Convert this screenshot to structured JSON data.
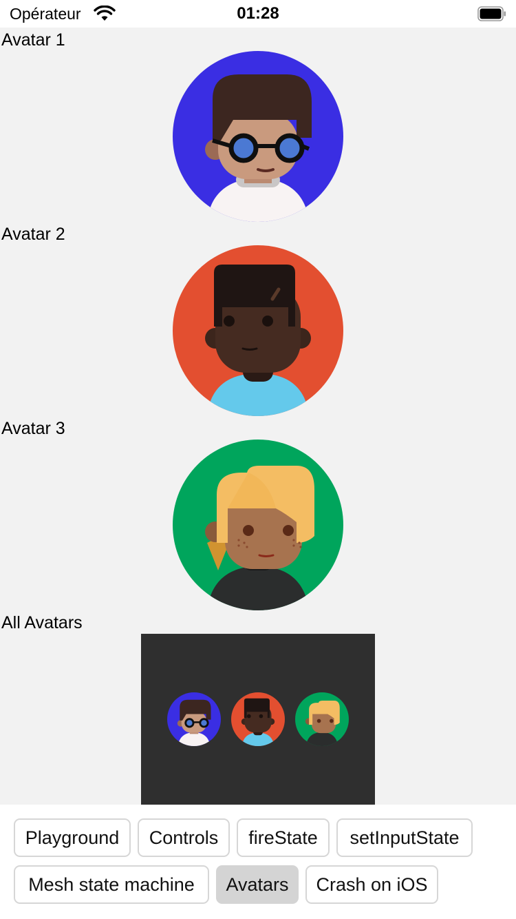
{
  "status_bar": {
    "carrier": "Opérateur",
    "time": "01:28"
  },
  "sections": [
    {
      "label": "Avatar 1",
      "avatar": "glasses-boy",
      "background": "#3a2ee3"
    },
    {
      "label": "Avatar 2",
      "avatar": "flat-top-boy",
      "background": "#e34f30"
    },
    {
      "label": "Avatar 3",
      "avatar": "blonde-girl",
      "background": "#00a55c"
    },
    {
      "label": "All Avatars"
    }
  ],
  "buttons": [
    {
      "label": "Playground",
      "selected": false
    },
    {
      "label": "Controls",
      "selected": false
    },
    {
      "label": "fireState",
      "selected": false
    },
    {
      "label": "setInputState",
      "selected": false
    },
    {
      "label": "Mesh state machine",
      "selected": false
    },
    {
      "label": "Avatars",
      "selected": true
    },
    {
      "label": "Crash on iOS",
      "selected": false
    }
  ],
  "icons": [
    "wifi-icon",
    "battery-icon"
  ]
}
